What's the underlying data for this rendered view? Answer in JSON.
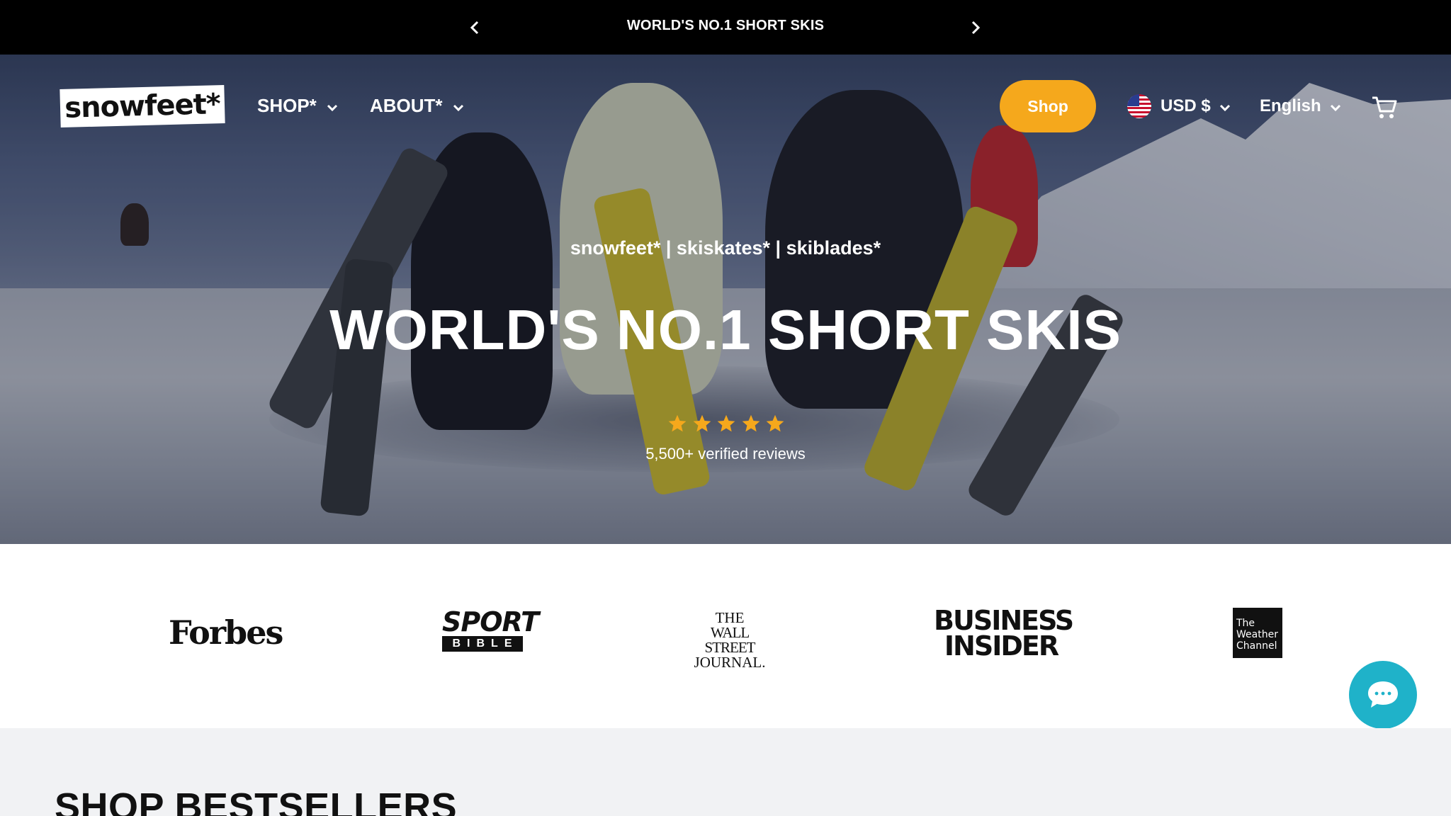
{
  "announcement": {
    "message": "WORLD'S NO.1 SHORT SKIS"
  },
  "header": {
    "logo_text": "snowfeet*",
    "nav": [
      {
        "label": "SHOP*"
      },
      {
        "label": "ABOUT*"
      }
    ],
    "shop_button": "Shop",
    "currency": "USD $",
    "language": "English"
  },
  "hero": {
    "subtitle": "snowfeet* | skiskates* | skiblades*",
    "title": "WORLD'S NO.1 SHORT SKIS",
    "rating_stars": 5,
    "reviews": "5,500+ verified reviews"
  },
  "press": {
    "forbes": "Forbes",
    "sport_bible": {
      "line1": "SPORT",
      "line2": "BIBLE"
    },
    "wsj": {
      "line1": "THE",
      "line2": "WALL STREET",
      "line3": "JOURNAL."
    },
    "business_insider": {
      "line1": "BUSINESS",
      "line2": "INSIDER"
    },
    "weather_channel": {
      "line1": "The",
      "line2": "Weather",
      "line3": "Channel"
    }
  },
  "bestsellers": {
    "heading": "SHOP BESTSELLERS"
  },
  "colors": {
    "accent": "#f5a81c",
    "chat": "#1fb2c9",
    "announcement_bg": "#000000"
  }
}
